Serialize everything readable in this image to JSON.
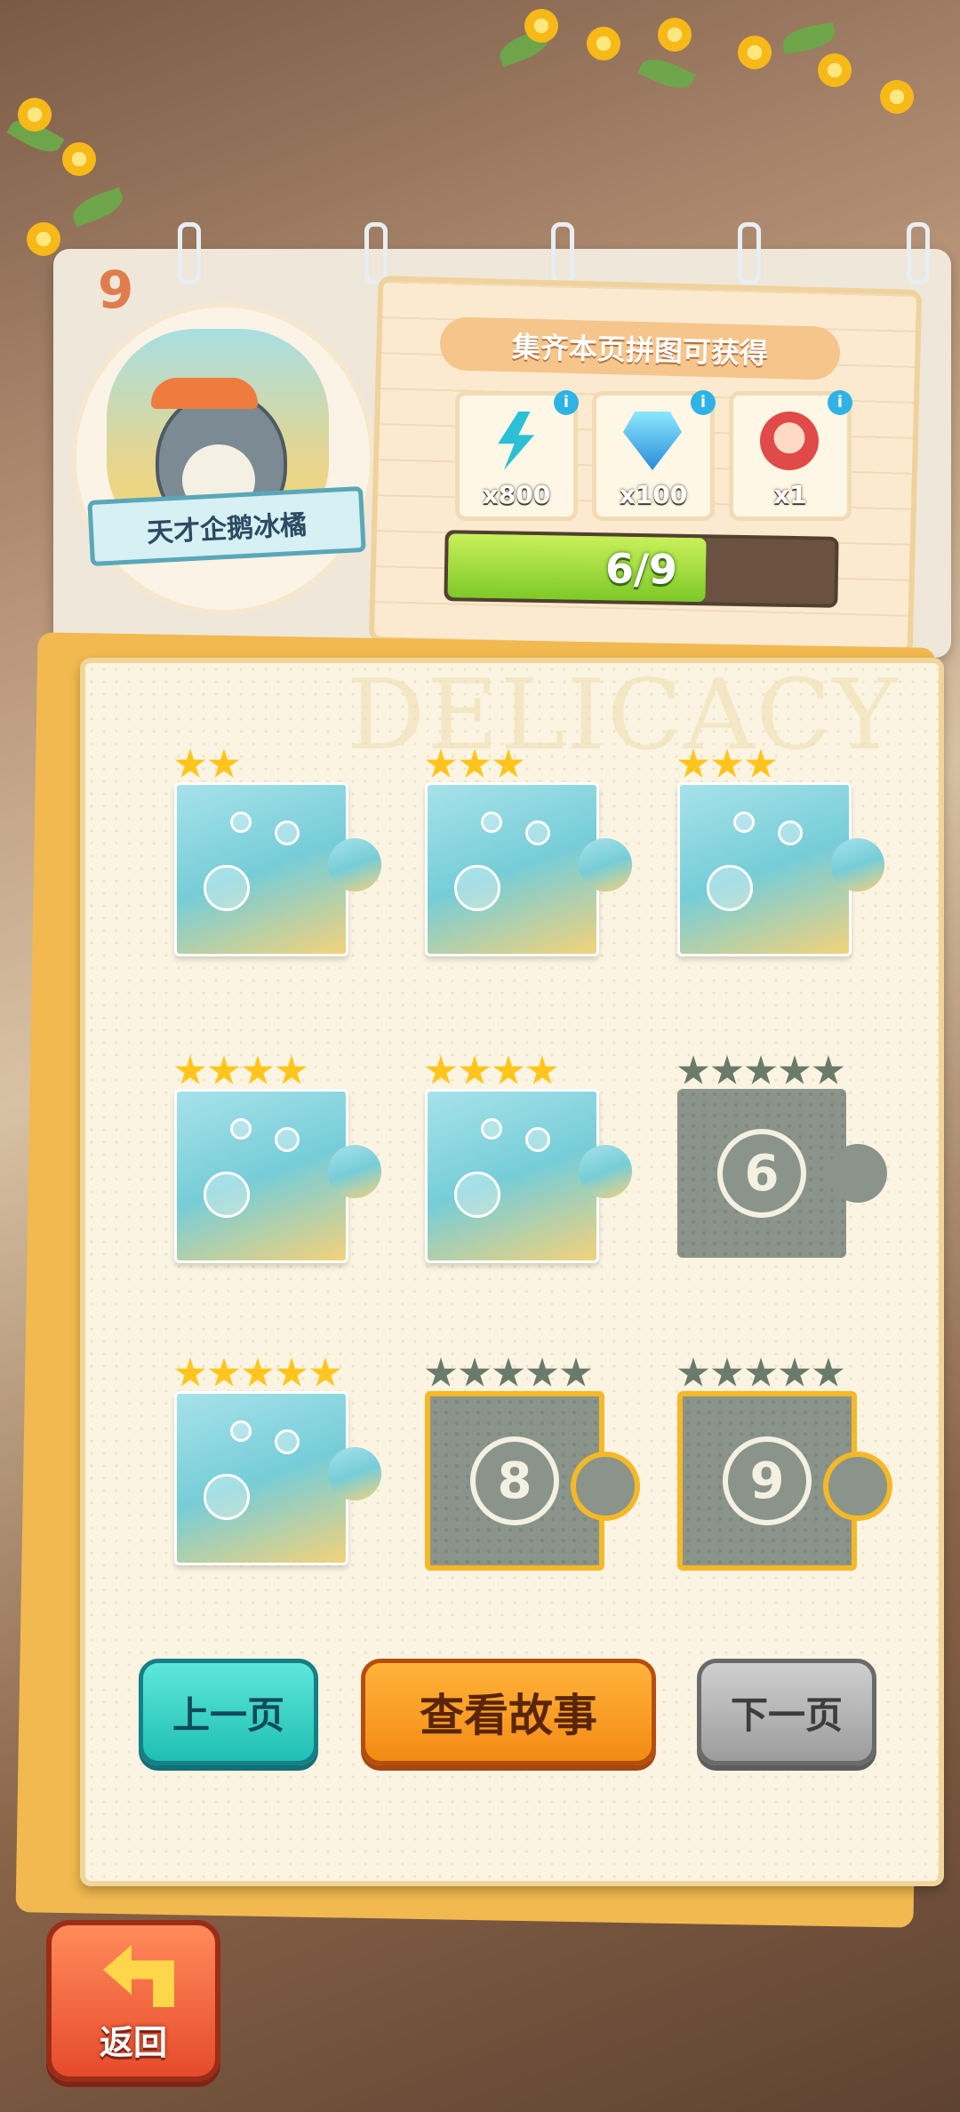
{
  "page": {
    "number": "9"
  },
  "badge": {
    "name": "天才企鹅冰橘"
  },
  "reward_panel": {
    "title": "集齐本页拼图可获得",
    "items": [
      {
        "icon": "lightning-energy-icon",
        "count": "x800"
      },
      {
        "icon": "blue-diamond-icon",
        "count": "x100"
      },
      {
        "icon": "jester-box-icon",
        "count": "x1"
      }
    ],
    "info_glyph": "i",
    "progress": {
      "text": "6/9",
      "current": 6,
      "total": 9
    }
  },
  "watermark": "DELICACY",
  "puzzle": {
    "pieces": [
      {
        "index": 1,
        "stars": 2,
        "max_stars": 2,
        "unlocked": true
      },
      {
        "index": 2,
        "stars": 3,
        "max_stars": 3,
        "unlocked": true
      },
      {
        "index": 3,
        "stars": 3,
        "max_stars": 3,
        "unlocked": true
      },
      {
        "index": 4,
        "stars": 4,
        "max_stars": 4,
        "unlocked": true
      },
      {
        "index": 5,
        "stars": 4,
        "max_stars": 4,
        "unlocked": true
      },
      {
        "index": 6,
        "stars": 0,
        "max_stars": 5,
        "unlocked": false,
        "label": "6"
      },
      {
        "index": 7,
        "stars": 5,
        "max_stars": 5,
        "unlocked": true
      },
      {
        "index": 8,
        "stars": 0,
        "max_stars": 5,
        "unlocked": false,
        "label": "8",
        "highlight": true
      },
      {
        "index": 9,
        "stars": 0,
        "max_stars": 5,
        "unlocked": false,
        "label": "9",
        "highlight": true
      }
    ]
  },
  "buttons": {
    "prev": "上一页",
    "story": "查看故事",
    "next": "下一页",
    "back": "返回"
  },
  "colors": {
    "star_gold": "#ffc51c",
    "star_locked": "#6a7a6b",
    "progress_fill": "#7ec928",
    "accent_orange": "#f38a14",
    "teal": "#1fbfb4"
  }
}
